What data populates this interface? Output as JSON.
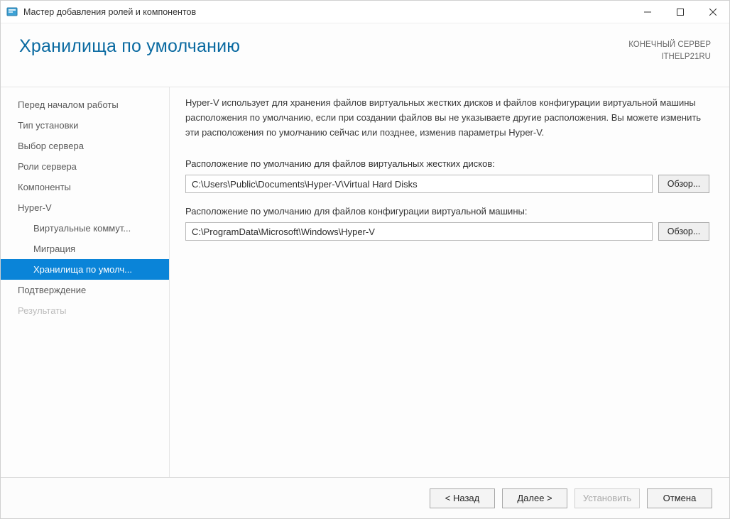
{
  "window": {
    "title": "Мастер добавления ролей и компонентов"
  },
  "header": {
    "heading": "Хранилища по умолчанию",
    "server_caption": "КОНЕЧНЫЙ СЕРВЕР",
    "server_name": "ITHELP21RU"
  },
  "steps": [
    {
      "label": "Перед началом работы",
      "sub": false,
      "selected": false,
      "disabled": false
    },
    {
      "label": "Тип установки",
      "sub": false,
      "selected": false,
      "disabled": false
    },
    {
      "label": "Выбор сервера",
      "sub": false,
      "selected": false,
      "disabled": false
    },
    {
      "label": "Роли сервера",
      "sub": false,
      "selected": false,
      "disabled": false
    },
    {
      "label": "Компоненты",
      "sub": false,
      "selected": false,
      "disabled": false
    },
    {
      "label": "Hyper-V",
      "sub": false,
      "selected": false,
      "disabled": false
    },
    {
      "label": "Виртуальные коммут...",
      "sub": true,
      "selected": false,
      "disabled": false
    },
    {
      "label": "Миграция",
      "sub": true,
      "selected": false,
      "disabled": false
    },
    {
      "label": "Хранилища по умолч...",
      "sub": true,
      "selected": true,
      "disabled": false
    },
    {
      "label": "Подтверждение",
      "sub": false,
      "selected": false,
      "disabled": false
    },
    {
      "label": "Результаты",
      "sub": false,
      "selected": false,
      "disabled": true
    }
  ],
  "content": {
    "intro": "Hyper-V использует для хранения файлов виртуальных жестких дисков и файлов конфигурации виртуальной машины расположения по умолчанию, если при создании файлов вы не указываете другие расположения. Вы можете изменить эти расположения по умолчанию сейчас или позднее, изменив параметры Hyper-V.",
    "vhd_label": "Расположение по умолчанию для файлов виртуальных жестких дисков:",
    "vhd_path": "C:\\Users\\Public\\Documents\\Hyper-V\\Virtual Hard Disks",
    "cfg_label": "Расположение по умолчанию для файлов конфигурации виртуальной машины:",
    "cfg_path": "C:\\ProgramData\\Microsoft\\Windows\\Hyper-V",
    "browse_label": "Обзор..."
  },
  "footer": {
    "back": "< Назад",
    "next": "Далее  >",
    "install": "Установить",
    "cancel": "Отмена",
    "install_enabled": false
  }
}
